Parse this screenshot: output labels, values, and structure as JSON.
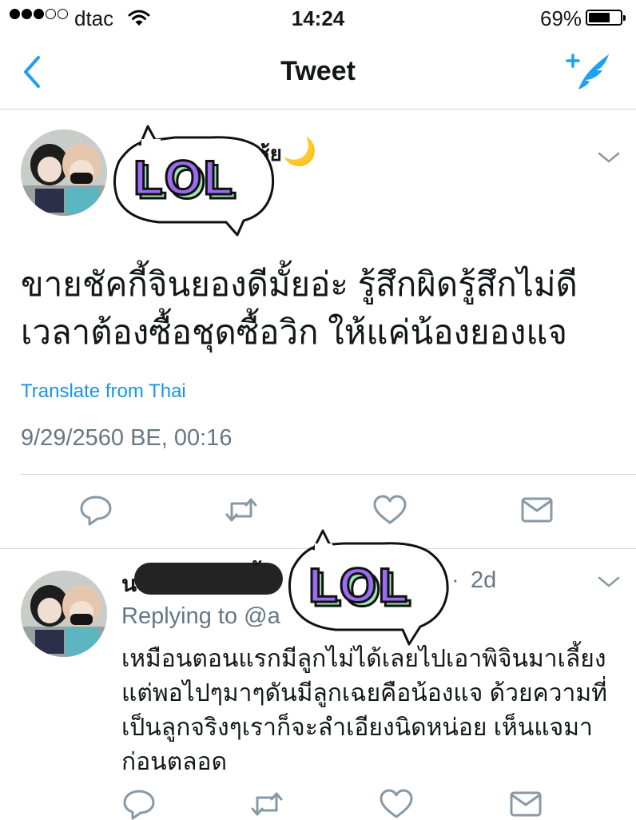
{
  "status_bar": {
    "signal_dots_filled": 3,
    "signal_dots_total": 5,
    "carrier": "dtac",
    "time": "14:24",
    "battery_percent_label": "69%",
    "battery_level": 0.69
  },
  "nav": {
    "title": "Tweet",
    "back_icon": "chevron-left-icon",
    "compose_icon": "compose-tweet-icon"
  },
  "tweet": {
    "name_fragment": "ซ้ย",
    "name_emoji": "🌙",
    "text": "ขายชัคกี้จินยองดีมั้ยอ่ะ รู้สึกผิดรู้สึกไม่ดี เวลาต้องซื้อชุดซื้อวิก ให้แค่น้องยองแจ",
    "translate_label": "Translate from Thai",
    "timestamp": "9/29/2560 BE, 00:16"
  },
  "sticker": {
    "text": "LOL"
  },
  "actions": {
    "reply_icon": "reply-icon",
    "retweet_icon": "retweet-icon",
    "like_icon": "heart-icon",
    "dm_icon": "mail-icon"
  },
  "reply": {
    "name_start": "น",
    "name_mark": "้",
    "time_separator": "·",
    "relative_time": "2d",
    "replying_to": "Replying to @a",
    "text": "เหมือนตอนแรกมีลูกไม่ได้เลยไปเอาพิจินมาเลี้ยง แต่พอไปๆมาๆดันมีลูกเฉยคือน้องแจ ด้วยความที่เป็นลูกจริงๆเราก็จะลำเอียงนิดหน่อย เห็นแจมาก่อนตลอด"
  },
  "colors": {
    "accent": "#1da1f2",
    "link": "#1b95e0",
    "secondary_text": "#657786",
    "icon_gray": "#8899a6",
    "divider": "#d3d8dc",
    "sticker_purple": "#9b6cf0",
    "sticker_green": "#9be6b4"
  }
}
